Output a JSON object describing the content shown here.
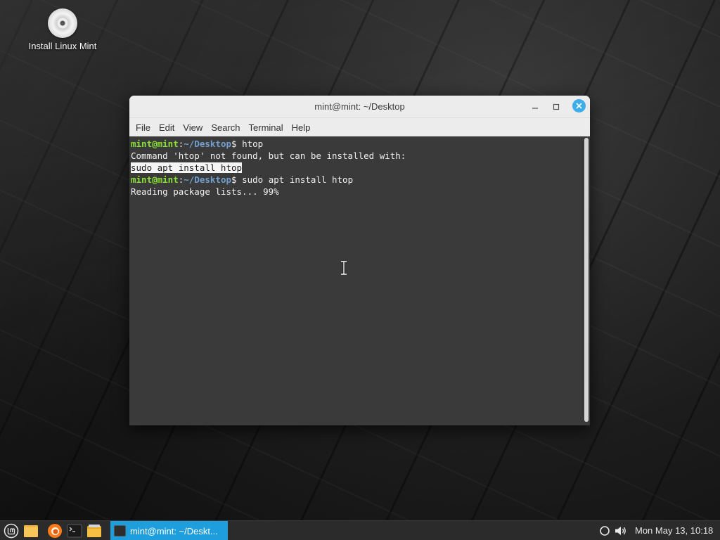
{
  "desktop": {
    "icons": [
      {
        "label": "Install Linux Mint",
        "icon": "disc-icon"
      }
    ]
  },
  "window": {
    "title": "mint@mint: ~/Desktop",
    "menus": [
      "File",
      "Edit",
      "View",
      "Search",
      "Terminal",
      "Help"
    ],
    "terminal": {
      "prompt_user": "mint@mint",
      "prompt_sep": ":",
      "prompt_path": "~/Desktop",
      "prompt_suffix": "$ ",
      "cmd1": "htop",
      "line2": "Command 'htop' not found, but can be installed with:",
      "line3_selected": "sudo apt install htop",
      "cmd2": "sudo apt install htop",
      "line5": "Reading package lists... 99%"
    }
  },
  "taskbar": {
    "launchers": [
      "mint-menu-icon",
      "folder-icon",
      "firefox-icon",
      "terminal-icon",
      "files-icon"
    ],
    "task_label": "mint@mint: ~/Deskt...",
    "clock": "Mon May 13, 10:18"
  },
  "colors": {
    "prompt_user": "#8ae234",
    "prompt_path": "#729fcf",
    "terminal_bg": "#3a3a3a",
    "accent": "#1f9ede",
    "close_button": "#3daee9"
  }
}
